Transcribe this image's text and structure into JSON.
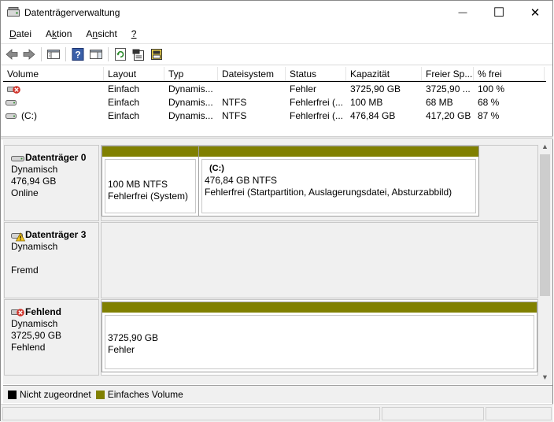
{
  "window": {
    "title": "Datenträgerverwaltung",
    "controls": {
      "minimize": "—",
      "maximize": "☐",
      "close": "✕"
    }
  },
  "menu": [
    {
      "label": "Datei",
      "underline": "D",
      "rest": "atei"
    },
    {
      "label": "Aktion",
      "underline": "k",
      "pre": "A",
      "rest": "tion"
    },
    {
      "label": "Ansicht",
      "underline": "n",
      "pre": "A",
      "rest": "sicht"
    },
    {
      "label": "?",
      "underline": "?",
      "rest": ""
    }
  ],
  "toolbar": {
    "icons": [
      "back-icon",
      "forward-icon",
      "console-tree-icon",
      "help-icon",
      "show-hide-action-pane-icon",
      "refresh-icon",
      "properties-icon",
      "disk-settings-icon"
    ]
  },
  "volume_table": {
    "columns": [
      "Volume",
      "Layout",
      "Typ",
      "Dateisystem",
      "Status",
      "Kapazität",
      "Freier Sp...",
      "% frei"
    ],
    "rows": [
      {
        "volume": "",
        "icon": "error-volume-icon",
        "layout": "Einfach",
        "typ": "Dynamis...",
        "fs": "",
        "status": "Fehler",
        "cap": "3725,90 GB",
        "free": "3725,90 ...",
        "pct": "100 %"
      },
      {
        "volume": "",
        "icon": "volume-icon",
        "layout": "Einfach",
        "typ": "Dynamis...",
        "fs": "NTFS",
        "status": "Fehlerfrei (...",
        "cap": "100 MB",
        "free": "68 MB",
        "pct": "68 %"
      },
      {
        "volume": "(C:)",
        "icon": "volume-icon",
        "layout": "Einfach",
        "typ": "Dynamis...",
        "fs": "NTFS",
        "status": "Fehlerfrei (...",
        "cap": "476,84 GB",
        "free": "417,20 GB",
        "pct": "87 %"
      }
    ]
  },
  "disks": [
    {
      "name": "Datenträger 0",
      "type": "Dynamisch",
      "size": "476,94 GB",
      "state": "Online",
      "partitions": [
        {
          "title": "",
          "line1": "100 MB NTFS",
          "line2": "Fehlerfrei (System)"
        },
        {
          "title": "(C:)",
          "line1": "476,84 GB NTFS",
          "line2": "Fehlerfrei (Startpartition, Auslagerungsdatei, Absturzabbild)"
        }
      ]
    },
    {
      "name": "Datenträger 3",
      "type": "Dynamisch",
      "size": "",
      "state": "Fremd",
      "partitions": []
    },
    {
      "name": "Fehlend",
      "type": "Dynamisch",
      "size": "3725,90 GB",
      "state": "Fehlend",
      "partitions": [
        {
          "title": "",
          "line1": "3725,90 GB",
          "line2": "Fehler"
        }
      ]
    }
  ],
  "legend": [
    {
      "label": "Nicht zugeordnet",
      "color": "#000000"
    },
    {
      "label": "Einfaches Volume",
      "color": "#808000"
    }
  ],
  "colors": {
    "simple_volume": "#808000",
    "unallocated": "#000000"
  }
}
